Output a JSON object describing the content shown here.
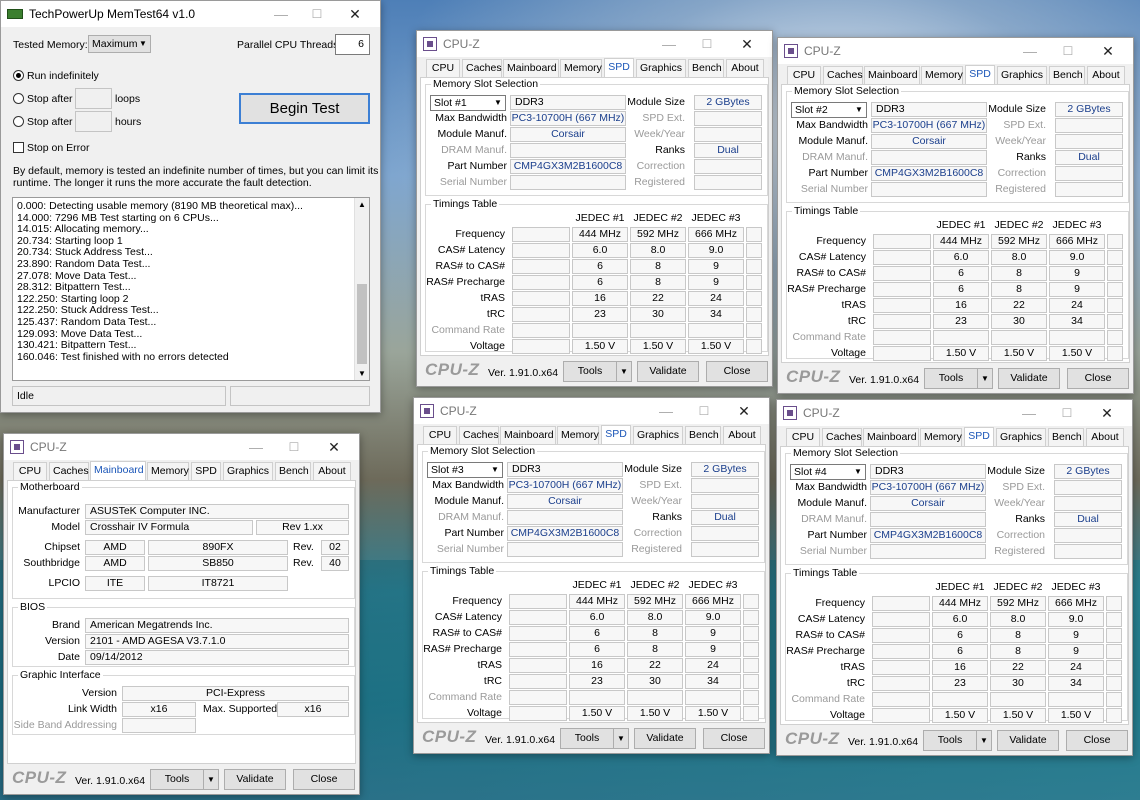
{
  "memtest": {
    "title": "TechPowerUp MemTest64 v1.0",
    "tested_memory_label": "Tested Memory:",
    "tested_memory_value": "Maximum",
    "threads_label": "Parallel CPU Threads:",
    "threads_value": "6",
    "run_indef": "Run indefinitely",
    "stop_after": "Stop after",
    "loops": "loops",
    "hours": "hours",
    "stop_on_error": "Stop on Error",
    "begin": "Begin Test",
    "desc1": "By default, memory is tested an indefinite number of times, but you can limit its",
    "desc2": "runtime. The longer it runs the more accurate the fault detection.",
    "log": [
      "0.000: Detecting usable memory (8190 MB theoretical max)...",
      "14.000: 7296 MB Test starting on 6 CPUs...",
      "14.015: Allocating memory...",
      "20.734: Starting loop 1",
      "20.734: Stuck Address Test...",
      "23.890: Random Data Test...",
      "27.078: Move Data Test...",
      "28.312: Bitpattern Test...",
      "122.250: Starting loop 2",
      "122.250: Stuck Address Test...",
      "125.437: Random Data Test...",
      "129.093: Move Data Test...",
      "130.421: Bitpattern Test...",
      "160.046: Test finished with no errors detected"
    ],
    "status": "Idle"
  },
  "cpuz_common": {
    "title": "CPU-Z",
    "tabs": [
      "CPU",
      "Caches",
      "Mainboard",
      "Memory",
      "SPD",
      "Graphics",
      "Bench",
      "About"
    ],
    "brand": "CPU-Z",
    "version": "Ver. 1.91.0.x64",
    "tools": "Tools",
    "validate": "Validate",
    "close": "Close"
  },
  "mainboard": {
    "mb_group": "Motherboard",
    "manufacturer_label": "Manufacturer",
    "manufacturer": "ASUSTeK Computer INC.",
    "model_label": "Model",
    "model": "Crosshair IV Formula",
    "rev_model": "Rev 1.xx",
    "chipset_label": "Chipset",
    "chipset_vendor": "AMD",
    "chipset": "890FX",
    "chipset_rev_label": "Rev.",
    "chipset_rev": "02",
    "south_label": "Southbridge",
    "south_vendor": "AMD",
    "south": "SB850",
    "south_rev_label": "Rev.",
    "south_rev": "40",
    "lpcio_label": "LPCIO",
    "lpcio_vendor": "ITE",
    "lpcio": "IT8721",
    "bios_group": "BIOS",
    "brand_label": "Brand",
    "brand": "American Megatrends Inc.",
    "version_label": "Version",
    "version": "2101 - AMD AGESA V3.7.1.0",
    "date_label": "Date",
    "date": "09/14/2012",
    "gi_group": "Graphic Interface",
    "gi_version_label": "Version",
    "gi_version": "PCI-Express",
    "link_label": "Link Width",
    "link": "x16",
    "maxsup_label": "Max. Supported",
    "maxsup": "x16",
    "sideband_label": "Side Band Addressing"
  },
  "spd_labels": {
    "slot_group": "Memory Slot Selection",
    "module_size": "Module Size",
    "max_bw": "Max Bandwidth",
    "spd_ext": "SPD Ext.",
    "module_manuf": "Module Manuf.",
    "week_year": "Week/Year",
    "dram_manuf": "DRAM Manuf.",
    "ranks": "Ranks",
    "part_number": "Part Number",
    "correction": "Correction",
    "serial": "Serial Number",
    "registered": "Registered",
    "timings_group": "Timings Table",
    "col1": "JEDEC #1",
    "col2": "JEDEC #2",
    "col3": "JEDEC #3",
    "rows": [
      "Frequency",
      "CAS# Latency",
      "RAS# to CAS#",
      "RAS# Precharge",
      "tRAS",
      "tRC",
      "Command Rate",
      "Voltage"
    ]
  },
  "spd_slots": [
    {
      "slot": "Slot #1",
      "type": "DDR3",
      "size": "2 GBytes",
      "bw": "PC3-10700H (667 MHz)",
      "manuf": "Corsair",
      "ranks": "Dual",
      "part": "CMP4GX3M2B1600C8"
    },
    {
      "slot": "Slot #2",
      "type": "DDR3",
      "size": "2 GBytes",
      "bw": "PC3-10700H (667 MHz)",
      "manuf": "Corsair",
      "ranks": "Dual",
      "part": "CMP4GX3M2B1600C8"
    },
    {
      "slot": "Slot #3",
      "type": "DDR3",
      "size": "2 GBytes",
      "bw": "PC3-10700H (667 MHz)",
      "manuf": "Corsair",
      "ranks": "Dual",
      "part": "CMP4GX3M2B1600C8"
    },
    {
      "slot": "Slot #4",
      "type": "DDR3",
      "size": "2 GBytes",
      "bw": "PC3-10700H (667 MHz)",
      "manuf": "Corsair",
      "ranks": "Dual",
      "part": "CMP4GX3M2B1600C8"
    }
  ],
  "spd_timings": [
    [
      "444 MHz",
      "592 MHz",
      "666 MHz"
    ],
    [
      "6.0",
      "8.0",
      "9.0"
    ],
    [
      "6",
      "8",
      "9"
    ],
    [
      "6",
      "8",
      "9"
    ],
    [
      "16",
      "22",
      "24"
    ],
    [
      "23",
      "30",
      "34"
    ],
    [
      "",
      "",
      ""
    ],
    [
      "1.50 V",
      "1.50 V",
      "1.50 V"
    ]
  ]
}
